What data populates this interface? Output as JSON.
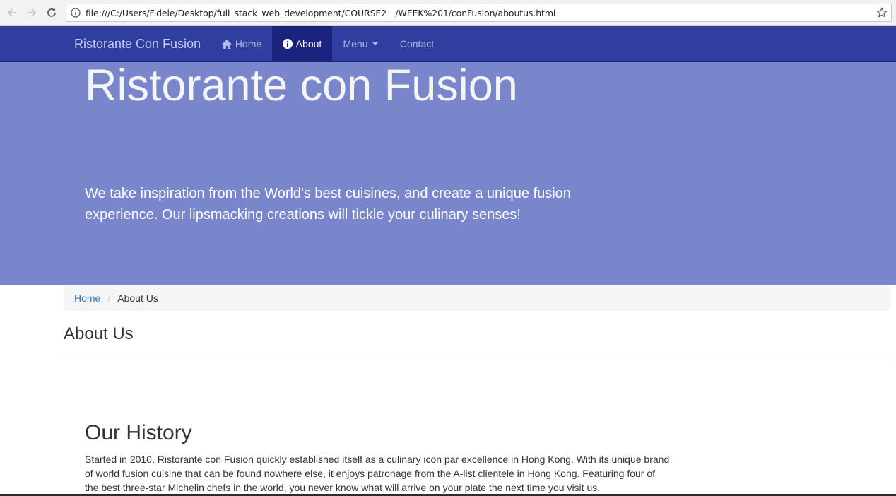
{
  "browser": {
    "url": "file:///C:/Users/Fidele/Desktop/full_stack_web_development/COURSE2__/WEEK%201/conFusion/aboutus.html",
    "back_icon": "arrow-left-icon",
    "forward_icon": "arrow-right-icon",
    "reload_icon": "reload-icon",
    "info_icon": "info-icon",
    "bookmark_icon": "star-icon"
  },
  "navbar": {
    "brand": "Ristorante Con Fusion",
    "items": [
      {
        "label": "Home",
        "icon": "home-icon"
      },
      {
        "label": "About",
        "icon": "info-circle-icon"
      },
      {
        "label": "Menu",
        "icon": "caret-down-icon"
      },
      {
        "label": "Contact"
      }
    ],
    "colors": {
      "background": "#303f9f",
      "active": "#1a237e"
    }
  },
  "jumbotron": {
    "title": "Ristorante con Fusion",
    "text": "We take inspiration from the World's best cuisines, and create a unique fusion experience. Our lipsmacking creations will tickle your culinary senses!",
    "color": "#7986cb"
  },
  "breadcrumb": {
    "home": "Home",
    "separator": "/",
    "current": "About Us"
  },
  "page": {
    "title": "About Us",
    "history_title": "Our History",
    "history_text": "Started in 2010, Ristorante con Fusion quickly established itself as a culinary icon par excellence in Hong Kong. With its unique brand of world fusion cuisine that can be found nowhere else, it enjoys patronage from the A-list clientele in Hong Kong. Featuring four of the best three-star Michelin chefs in the world, you never know what will arrive on your plate the next time you visit us."
  }
}
